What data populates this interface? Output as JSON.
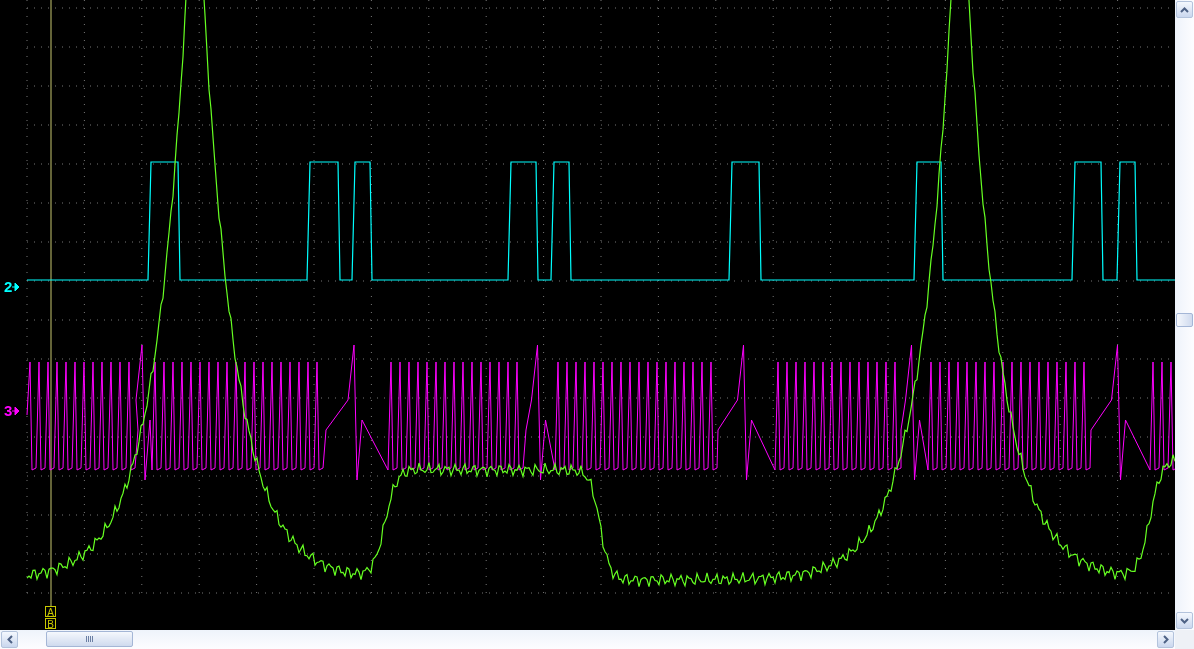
{
  "channels": [
    {
      "label": "2",
      "color": "#00ffff"
    },
    {
      "label": "3",
      "color": "#ff00ff"
    }
  ],
  "cursors": [
    {
      "label": "A"
    },
    {
      "label": "B"
    }
  ]
}
